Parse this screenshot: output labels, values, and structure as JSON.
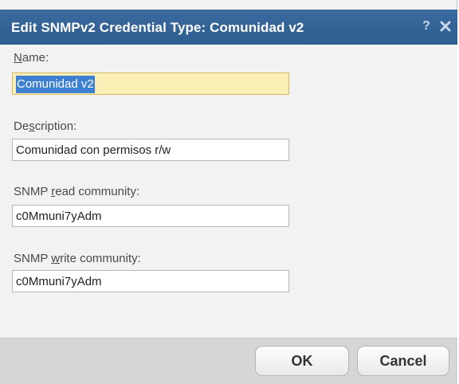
{
  "dialog": {
    "title": "Edit SNMPv2 Credential Type: Comunidad v2",
    "help_glyph": "?",
    "help_icon": "question-mark-icon",
    "close_icon": "close-icon",
    "title_bar_color": "#2e5d90"
  },
  "fields": {
    "name": {
      "label_prefix": "",
      "label_access": "N",
      "label_suffix": "ame:",
      "value": "Comunidad v2",
      "highlight_color": "#fbefb8",
      "selection_color": "#3d7fd0"
    },
    "description": {
      "label_prefix": "De",
      "label_access": "s",
      "label_suffix": "cription:",
      "value": "Comunidad con permisos r/w"
    },
    "read_community": {
      "label_prefix": "SNMP ",
      "label_access": "r",
      "label_suffix": "ead community:",
      "value": "c0Mmuni7yAdm"
    },
    "write_community": {
      "label_prefix": "SNMP ",
      "label_access": "w",
      "label_suffix": "rite community:",
      "value": "c0Mmuni7yAdm"
    }
  },
  "buttons": {
    "ok_label": "OK",
    "cancel_label": "Cancel"
  }
}
